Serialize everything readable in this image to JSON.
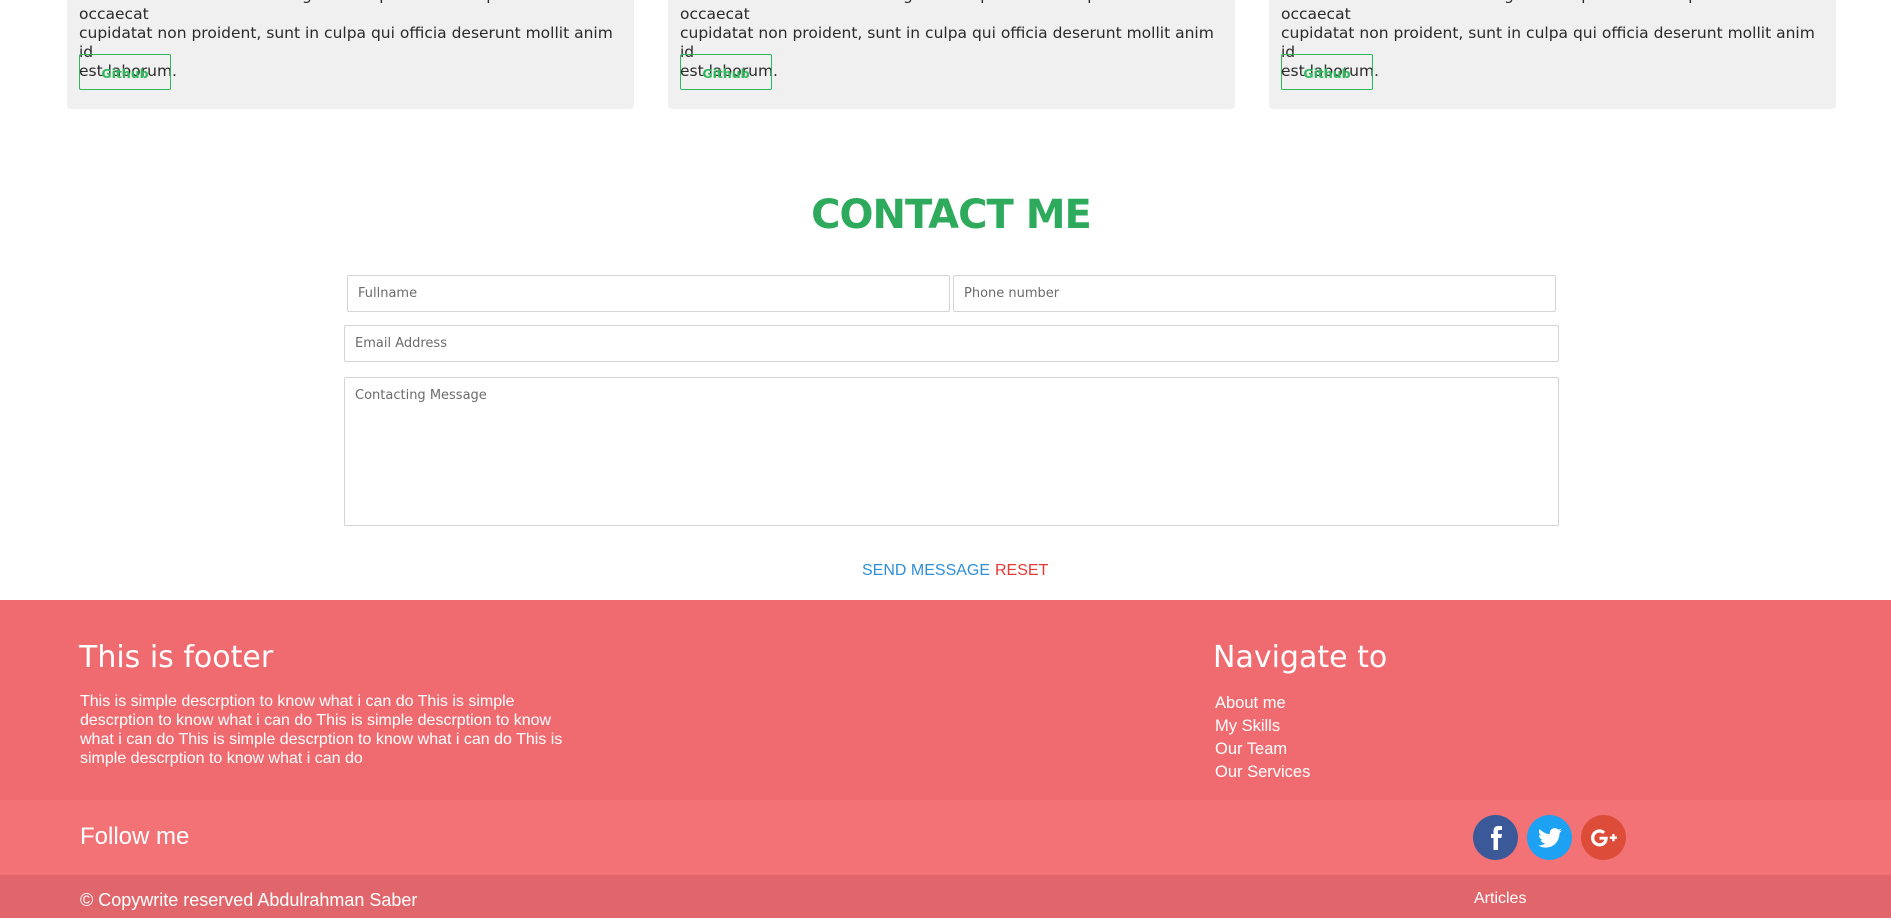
{
  "projects": [
    {
      "text_line1": "velit esse cillum dolore eu fugiat nulla pariatur. Excepteur sint occaecat",
      "text_line2": "cupidatat non proident, sunt in culpa qui officia deserunt mollit anim id",
      "text_line3": "est laborum.",
      "button_label": "Github"
    },
    {
      "text_line1": "velit esse cillum dolore eu fugiat nulla pariatur. Excepteur sint occaecat",
      "text_line2": "cupidatat non proident, sunt in culpa qui officia deserunt mollit anim id",
      "text_line3": "est laborum.",
      "button_label": "Github"
    },
    {
      "text_line1": "velit esse cillum dolore eu fugiat nulla pariatur. Excepteur sint occaecat",
      "text_line2": "cupidatat non proident, sunt in culpa qui officia deserunt mollit anim id",
      "text_line3": "est laborum.",
      "button_label": "Github"
    }
  ],
  "contact": {
    "title": "CONTACT ME",
    "fullname_placeholder": "Fullname",
    "phone_placeholder": "Phone number",
    "email_placeholder": "Email Address",
    "message_placeholder": "Contacting Message",
    "send_label": "SEND MESSAGE",
    "reset_label": "RESET"
  },
  "footer": {
    "heading": "This is footer",
    "description": "This is simple descrption to know what i can do This is simple descrption to know what i can do This is simple descrption to know what i can do This is simple descrption to know what i can do This is simple descrption to know what i can do",
    "nav_heading": "Navigate to",
    "nav_items": [
      "About me",
      "My Skills",
      "Our Team",
      "Our Services"
    ],
    "follow_title": "Follow me",
    "social_icons": [
      "facebook-icon",
      "twitter-icon",
      "google-plus-icon"
    ],
    "copyright": "© Copywrite reserved Abdulrahman Saber",
    "articles_link": "Articles"
  },
  "colors": {
    "accent_green": "#2eaa5c",
    "footer_bg": "#ef6b70",
    "facebook": "#3b5998",
    "twitter": "#1da1f2",
    "google_plus": "#dd4b39",
    "send": "#2e8fd8",
    "reset": "#e53935"
  }
}
